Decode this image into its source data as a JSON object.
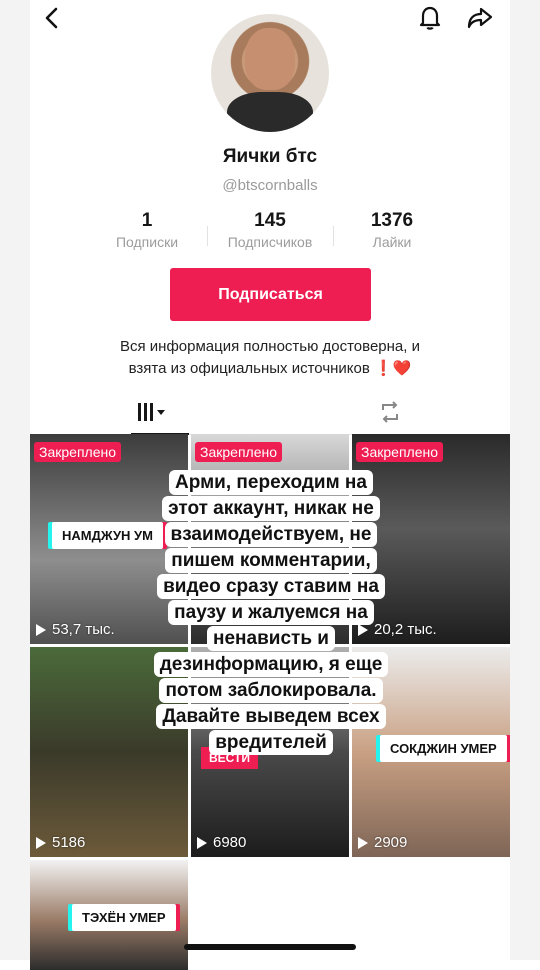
{
  "profile": {
    "name": "Яички бтс",
    "handle": "@btscornballs"
  },
  "stats": [
    {
      "value": "1",
      "label": "Подписки"
    },
    {
      "value": "145",
      "label": "Подписчиков"
    },
    {
      "value": "1376",
      "label": "Лайки"
    }
  ],
  "follow_button": "Подписаться",
  "bio": {
    "line1": "Вся информация полностью достоверна, и",
    "line2": "взята из официальных источников",
    "emoji": "❗️❤️"
  },
  "grid": [
    {
      "pinned": "Закреплено",
      "tag": "НАМДЖУН УМ",
      "views": "53,7 тыс."
    },
    {
      "pinned": "Закреплено",
      "tag": "",
      "views": ""
    },
    {
      "pinned": "Закреплено",
      "tag": "",
      "views": "20,2 тыс."
    },
    {
      "pinned": "",
      "tag": "",
      "views": "5186"
    },
    {
      "pinned": "",
      "tag": "ВЕСТИ",
      "views": "6980"
    },
    {
      "pinned": "",
      "tag": "СОКДЖИН УМЕР",
      "views": "2909"
    },
    {
      "pinned": "",
      "tag": "ТЭХЁН УМЕР",
      "views": ""
    }
  ],
  "overlay_text": [
    "Арми, переходим на",
    "этот аккаунт, никак не",
    "взаимодействуем, не",
    "пишем комментарии,",
    "видео сразу ставим на",
    "паузу и жалуемся на",
    "ненависть и",
    "дезинформацию, я еще",
    "потом заблокировала.",
    "Давайте выведем всех",
    "вредителей"
  ],
  "colors": {
    "accent": "#ee1d52",
    "cyan": "#25f4ee"
  },
  "icons": [
    "back-chevron-icon",
    "bell-icon",
    "share-icon",
    "grid-icon",
    "repost-icon",
    "play-icon"
  ]
}
